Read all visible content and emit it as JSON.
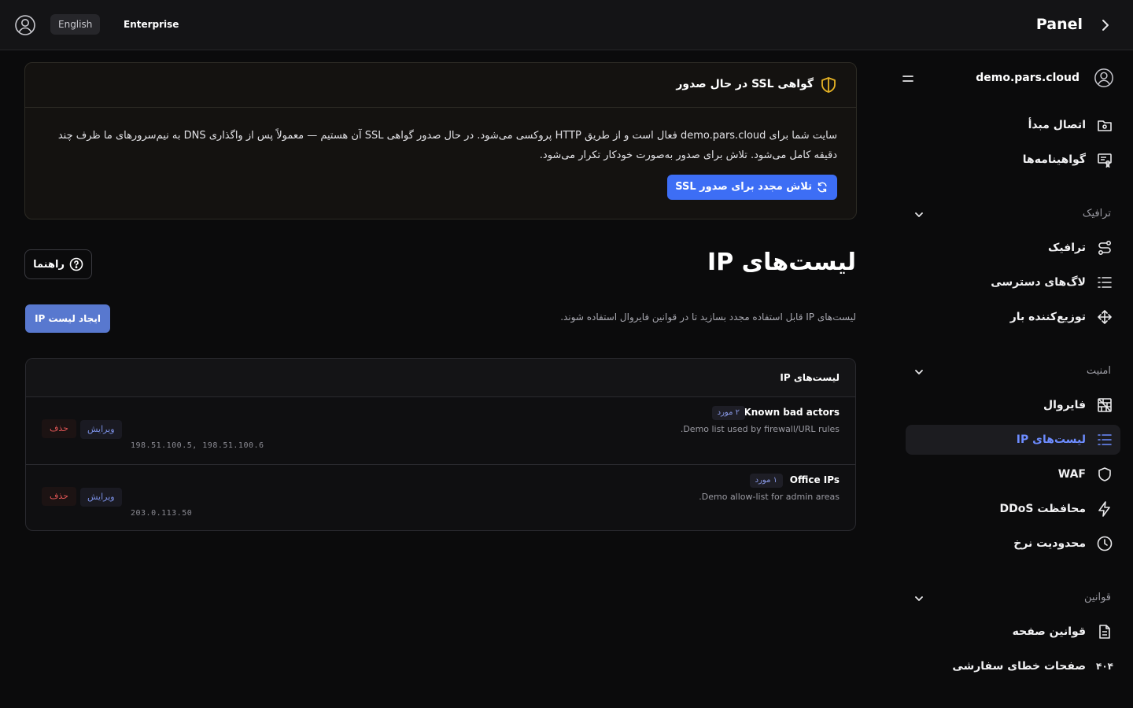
{
  "topbar": {
    "language": "English",
    "plan": "Enterprise",
    "panel_label": "Panel"
  },
  "sidebar": {
    "site": "demo.pars.cloud",
    "top_items": [
      {
        "label": "اتصال مبدأ",
        "icon": "folder-link-icon"
      },
      {
        "label": "گواهینامه‌ها",
        "icon": "certificate-icon"
      }
    ],
    "sections": [
      {
        "label": "ترافیک",
        "items": [
          {
            "label": "ترافیک",
            "icon": "route-icon"
          },
          {
            "label": "لاگ‌های دسترسی",
            "icon": "list-icon"
          },
          {
            "label": "توزیع‌کننده بار",
            "icon": "load-balancer-icon"
          }
        ]
      },
      {
        "label": "امنیت",
        "items": [
          {
            "label": "فایروال",
            "icon": "firewall-icon"
          },
          {
            "label": "لیست‌های IP",
            "icon": "ip-list-icon",
            "active": true
          },
          {
            "label": "WAF",
            "icon": "shield-icon"
          },
          {
            "label": "محافظت DDoS",
            "icon": "bolt-icon"
          },
          {
            "label": "محدودیت نرخ",
            "icon": "clock-icon"
          }
        ]
      },
      {
        "label": "قوانین",
        "items": [
          {
            "label": "قوانین صفحه",
            "icon": "document-icon"
          },
          {
            "label": "صفحات خطای سفارشی",
            "icon": "error-404-icon",
            "glyph": "۴۰۴"
          }
        ]
      }
    ]
  },
  "ssl_banner": {
    "title": "گواهی SSL در حال صدور",
    "message": "سایت شما برای demo.pars.cloud فعال است و از طریق HTTP پروکسی می‌شود. در حال صدور گواهی SSL آن هستیم — معمولاً پس از واگذاری DNS به نیم‌سرورهای ما ظرف چند دقیقه کامل می‌شود. تلاش برای صدور به‌صورت خودکار تکرار می‌شود.",
    "retry_label": "تلاش مجدد برای صدور SSL"
  },
  "page": {
    "title": "لیست‌های IP",
    "subtitle": "لیست‌های IP قابل استفاده مجدد بسازید تا در قوانین فایروال استفاده شوند.",
    "help_label": "راهنما",
    "create_label": "ایجاد لیست IP"
  },
  "ip_lists": {
    "card_title": "لیست‌های IP",
    "edit_label": "ویرایش",
    "delete_label": "حذف",
    "rows": [
      {
        "name": "Known bad actors",
        "count": "۲ مورد",
        "description": ".Demo list used by firewall/URL rules",
        "ips": "198.51.100.5, 198.51.100.6"
      },
      {
        "name": "Office IPs",
        "count": "۱ مورد",
        "description": ".Demo allow-list for admin areas",
        "ips": "203.0.113.50"
      }
    ]
  },
  "colors": {
    "accent": "#3d6ef5",
    "active_nav": "#6d8cff",
    "warning": "#e6b325",
    "danger": "#e05555"
  }
}
